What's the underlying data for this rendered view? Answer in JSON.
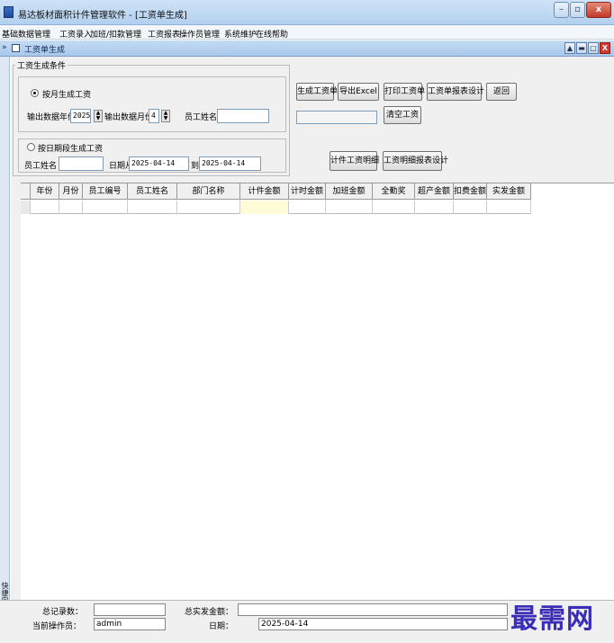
{
  "window": {
    "title": "易达板材面积计件管理软件 - [工资单生成]"
  },
  "menu": [
    "基础数据管理",
    "工资录入",
    "加班/扣款管理",
    "工资报表",
    "操作员管理",
    "系统维护",
    "在线帮助"
  ],
  "child": {
    "arrows": "»",
    "title": "工资单生成"
  },
  "side_panel": {
    "label": "快捷向导"
  },
  "conditions": {
    "legend": "工资生成条件",
    "by_month": {
      "label": "按月生成工资",
      "year_label": "输出数据年份",
      "year_value": "2025",
      "month_label": "输出数据月份",
      "month_value": "4",
      "name_label": "员工姓名",
      "name_value": ""
    },
    "by_date": {
      "label": "按日期段生成工资",
      "name_label": "员工姓名",
      "name_value": "",
      "from_label": "日期从",
      "from_value": "2025-04-14",
      "to_label": "到",
      "to_value": "2025-04-14"
    }
  },
  "buttons": {
    "generate": "生成工资单",
    "export": "导出Excel",
    "print": "打印工资单",
    "report_design": "工资单报表设计",
    "back": "返回",
    "clear": "清空工资",
    "piece_detail": "计件工资明细",
    "detail_design": "工资明细报表设计"
  },
  "progress_value": "",
  "table": {
    "columns": [
      "年份",
      "月份",
      "员工编号",
      "员工姓名",
      "部门名称",
      "计件金额",
      "计时金额",
      "加班金额",
      "全勤奖",
      "超产金额",
      "扣费金额",
      "实发金额"
    ],
    "rows": []
  },
  "status": {
    "record_count_label": "总记录数：",
    "record_count_value": "",
    "total_paid_label": "总实发金额：",
    "total_paid_value": "",
    "operator_label": "当前操作员：",
    "operator_value": "admin",
    "date_label": "日期：",
    "date_value": "2025-04-14"
  },
  "watermark": "最需网"
}
